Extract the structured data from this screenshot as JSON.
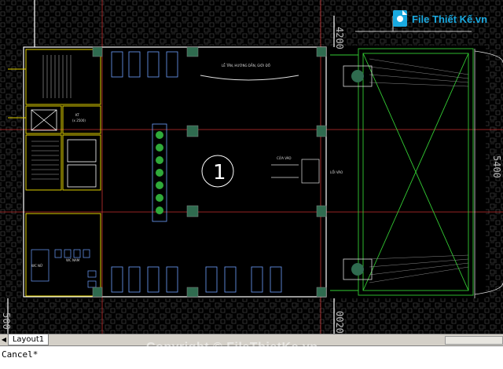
{
  "drawing": {
    "room_number": "1",
    "lobby_heading": "LỄ TÂN, HƯỚNG DẪN, GIỚI ĐỒ",
    "entrance_label": "CỬA VÀO",
    "exit_label": "LỐI VÀO",
    "elevator_label": "KT",
    "elevator_sub": "(x 2500)",
    "wc_label": "WC NỮ",
    "wc_label_2": "WC NAM",
    "dim_top": "4200",
    "dim_right": "5400",
    "dim_bottom_left": "500",
    "dim_bottom_right": "0020"
  },
  "layout_tabs": {
    "nav": "◀",
    "active": "Layout1"
  },
  "command_line": {
    "text": "Cancel*"
  },
  "watermark": {
    "copyright": "Copyright © FileThietKe.vn"
  },
  "logo": {
    "text": "File Thiết Kế.vn"
  },
  "colors": {
    "background": "#000000",
    "walls": "#ffffff",
    "columns": "#2f6b4f",
    "grid_lines": "#c83232",
    "green_lines": "#33cc33",
    "yellow_lines": "#e0d000",
    "furniture": "#6ea0ff"
  }
}
